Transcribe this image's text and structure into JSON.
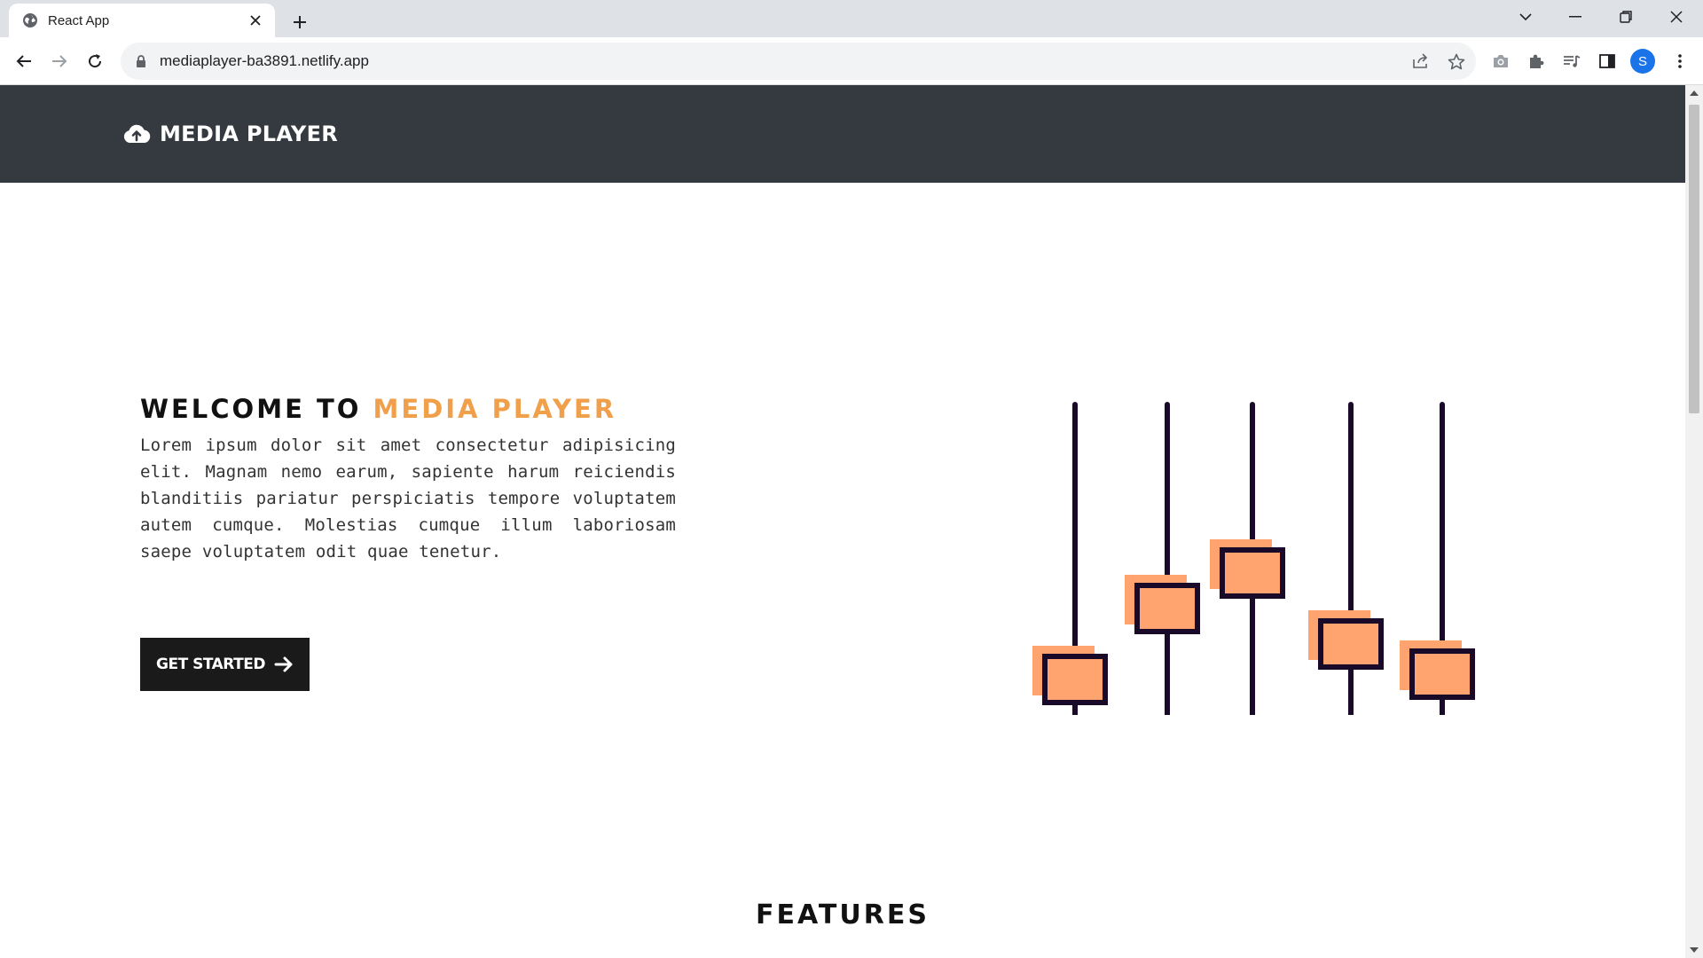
{
  "browser": {
    "tab_title": "React App",
    "url": "mediaplayer-ba3891.netlify.app",
    "profile_initial": "S"
  },
  "site": {
    "brand": "MEDIA PLAYER",
    "hero": {
      "title_prefix": "WELCOME TO",
      "title_accent": "MEDIA PLAYER",
      "body": "Lorem ipsum dolor sit amet consectetur adipisicing elit. Magnam nemo earum, sapiente harum reiciendis blanditiis pariatur perspiciatis tempore voluptatem autem cumque. Molestias cumque illum laboriosam saepe voluptatem odit quae tenetur.",
      "cta_label": "GET STARTED"
    },
    "features_heading": "FEATURES"
  },
  "colors": {
    "nav_bg": "#343a40",
    "accent": "#f0a04b",
    "slider_fill": "#ffa46e",
    "slider_stroke": "#1a0a2a",
    "cta_bg": "#1a1a1a"
  },
  "icons": {
    "brand": "cloud-upload-icon",
    "cta": "arrow-right-icon",
    "favicon": "globe-icon"
  }
}
